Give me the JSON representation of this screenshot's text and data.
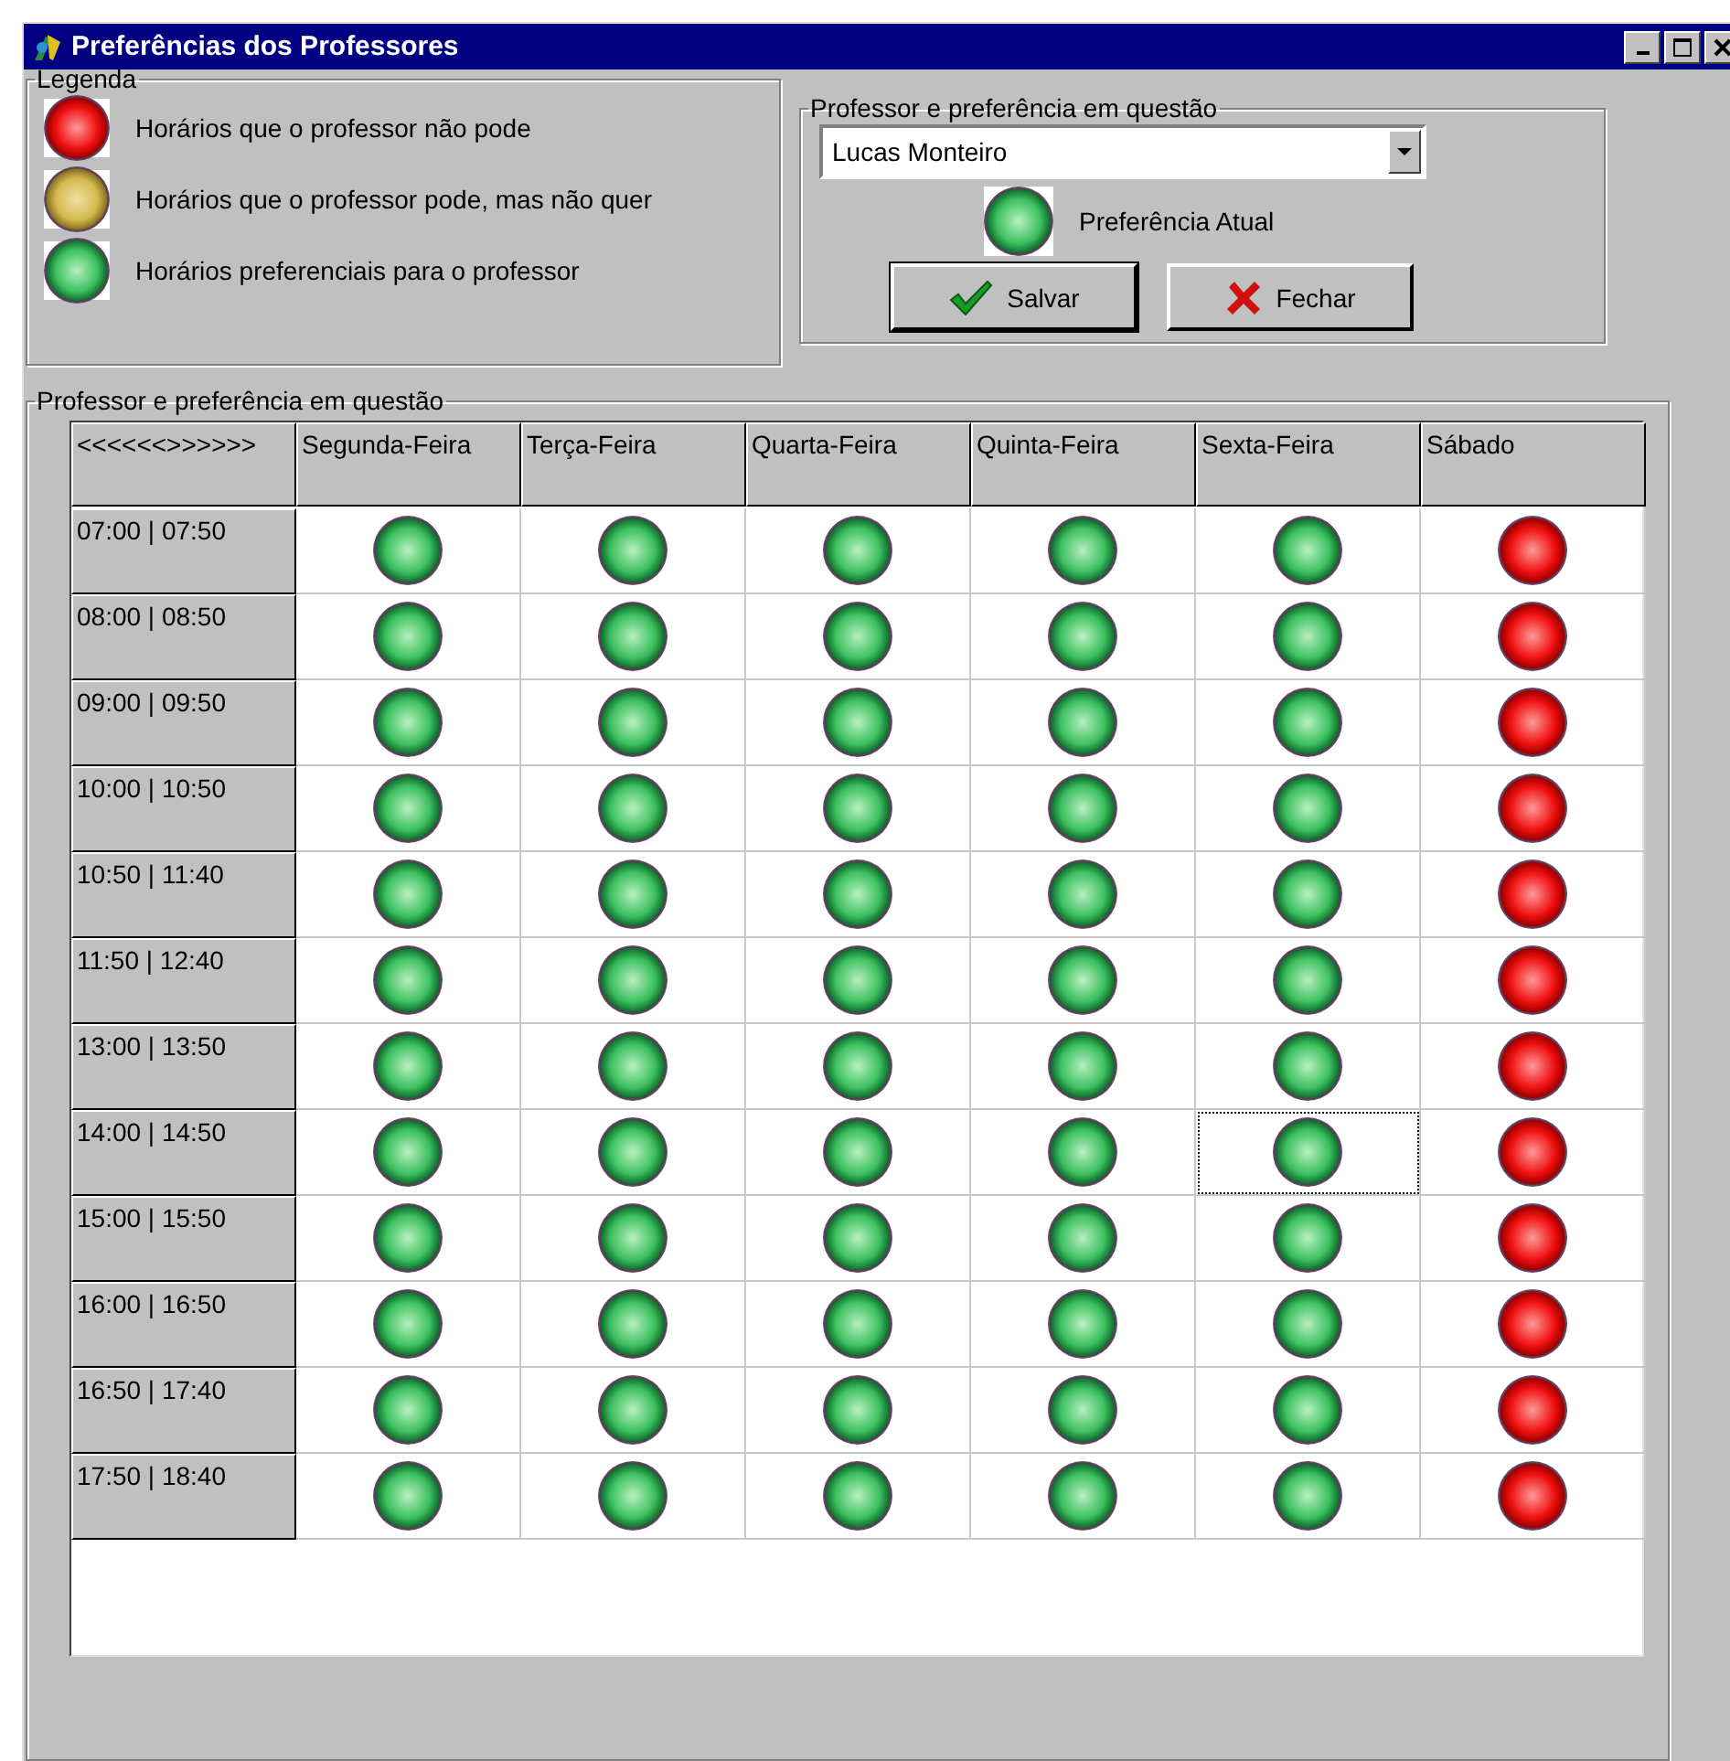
{
  "window": {
    "title": "Preferências dos Professores"
  },
  "legend": {
    "title": "Legenda",
    "items": [
      {
        "kind": "unavailable",
        "label": "Horários que o professor não pode"
      },
      {
        "kind": "reluctant",
        "label": "Horários que o professor pode, mas não quer"
      },
      {
        "kind": "preferred",
        "label": "Horários preferenciais para o professor"
      }
    ]
  },
  "selection": {
    "title": "Professor e preferência em questão",
    "professor": "Lucas Monteiro",
    "current_preference": {
      "kind": "preferred",
      "label": "Preferência Atual"
    },
    "buttons": [
      {
        "kind": "save",
        "label": "Salvar"
      },
      {
        "kind": "close",
        "label": "Fechar"
      }
    ]
  },
  "grid": {
    "title": "Professor e preferência em questão",
    "corner": "<<<<<<>>>>>>",
    "columns": [
      "Segunda-Feira",
      "Terça-Feira",
      "Quarta-Feira",
      "Quinta-Feira",
      "Sexta-Feira",
      "Sábado"
    ],
    "rows": [
      {
        "time": "07:00 | 07:50",
        "cells": [
          {
            "kind": "preferred",
            "selected": false
          },
          {
            "kind": "preferred",
            "selected": false
          },
          {
            "kind": "preferred",
            "selected": false
          },
          {
            "kind": "preferred",
            "selected": false
          },
          {
            "kind": "preferred",
            "selected": false
          },
          {
            "kind": "unavailable",
            "selected": false
          }
        ]
      },
      {
        "time": "08:00 | 08:50",
        "cells": [
          {
            "kind": "preferred",
            "selected": false
          },
          {
            "kind": "preferred",
            "selected": false
          },
          {
            "kind": "preferred",
            "selected": false
          },
          {
            "kind": "preferred",
            "selected": false
          },
          {
            "kind": "preferred",
            "selected": false
          },
          {
            "kind": "unavailable",
            "selected": false
          }
        ]
      },
      {
        "time": "09:00 | 09:50",
        "cells": [
          {
            "kind": "preferred",
            "selected": false
          },
          {
            "kind": "preferred",
            "selected": false
          },
          {
            "kind": "preferred",
            "selected": false
          },
          {
            "kind": "preferred",
            "selected": false
          },
          {
            "kind": "preferred",
            "selected": false
          },
          {
            "kind": "unavailable",
            "selected": false
          }
        ]
      },
      {
        "time": "10:00 | 10:50",
        "cells": [
          {
            "kind": "preferred",
            "selected": false
          },
          {
            "kind": "preferred",
            "selected": false
          },
          {
            "kind": "preferred",
            "selected": false
          },
          {
            "kind": "preferred",
            "selected": false
          },
          {
            "kind": "preferred",
            "selected": false
          },
          {
            "kind": "unavailable",
            "selected": false
          }
        ]
      },
      {
        "time": "10:50 | 11:40",
        "cells": [
          {
            "kind": "preferred",
            "selected": false
          },
          {
            "kind": "preferred",
            "selected": false
          },
          {
            "kind": "preferred",
            "selected": false
          },
          {
            "kind": "preferred",
            "selected": false
          },
          {
            "kind": "preferred",
            "selected": false
          },
          {
            "kind": "unavailable",
            "selected": false
          }
        ]
      },
      {
        "time": "11:50 | 12:40",
        "cells": [
          {
            "kind": "preferred",
            "selected": false
          },
          {
            "kind": "preferred",
            "selected": false
          },
          {
            "kind": "preferred",
            "selected": false
          },
          {
            "kind": "preferred",
            "selected": false
          },
          {
            "kind": "preferred",
            "selected": false
          },
          {
            "kind": "unavailable",
            "selected": false
          }
        ]
      },
      {
        "time": "13:00 | 13:50",
        "cells": [
          {
            "kind": "preferred",
            "selected": false
          },
          {
            "kind": "preferred",
            "selected": false
          },
          {
            "kind": "preferred",
            "selected": false
          },
          {
            "kind": "preferred",
            "selected": false
          },
          {
            "kind": "preferred",
            "selected": false
          },
          {
            "kind": "unavailable",
            "selected": false
          }
        ]
      },
      {
        "time": "14:00 | 14:50",
        "cells": [
          {
            "kind": "preferred",
            "selected": false
          },
          {
            "kind": "preferred",
            "selected": false
          },
          {
            "kind": "preferred",
            "selected": false
          },
          {
            "kind": "preferred",
            "selected": false
          },
          {
            "kind": "preferred",
            "selected": true
          },
          {
            "kind": "unavailable",
            "selected": false
          }
        ]
      },
      {
        "time": "15:00 | 15:50",
        "cells": [
          {
            "kind": "preferred",
            "selected": false
          },
          {
            "kind": "preferred",
            "selected": false
          },
          {
            "kind": "preferred",
            "selected": false
          },
          {
            "kind": "preferred",
            "selected": false
          },
          {
            "kind": "preferred",
            "selected": false
          },
          {
            "kind": "unavailable",
            "selected": false
          }
        ]
      },
      {
        "time": "16:00 | 16:50",
        "cells": [
          {
            "kind": "preferred",
            "selected": false
          },
          {
            "kind": "preferred",
            "selected": false
          },
          {
            "kind": "preferred",
            "selected": false
          },
          {
            "kind": "preferred",
            "selected": false
          },
          {
            "kind": "preferred",
            "selected": false
          },
          {
            "kind": "unavailable",
            "selected": false
          }
        ]
      },
      {
        "time": "16:50 | 17:40",
        "cells": [
          {
            "kind": "preferred",
            "selected": false
          },
          {
            "kind": "preferred",
            "selected": false
          },
          {
            "kind": "preferred",
            "selected": false
          },
          {
            "kind": "preferred",
            "selected": false
          },
          {
            "kind": "preferred",
            "selected": false
          },
          {
            "kind": "unavailable",
            "selected": false
          }
        ]
      },
      {
        "time": "17:50 | 18:40",
        "cells": [
          {
            "kind": "preferred",
            "selected": false
          },
          {
            "kind": "preferred",
            "selected": false
          },
          {
            "kind": "preferred",
            "selected": false
          },
          {
            "kind": "preferred",
            "selected": false
          },
          {
            "kind": "preferred",
            "selected": false
          },
          {
            "kind": "unavailable",
            "selected": false
          }
        ]
      }
    ]
  }
}
